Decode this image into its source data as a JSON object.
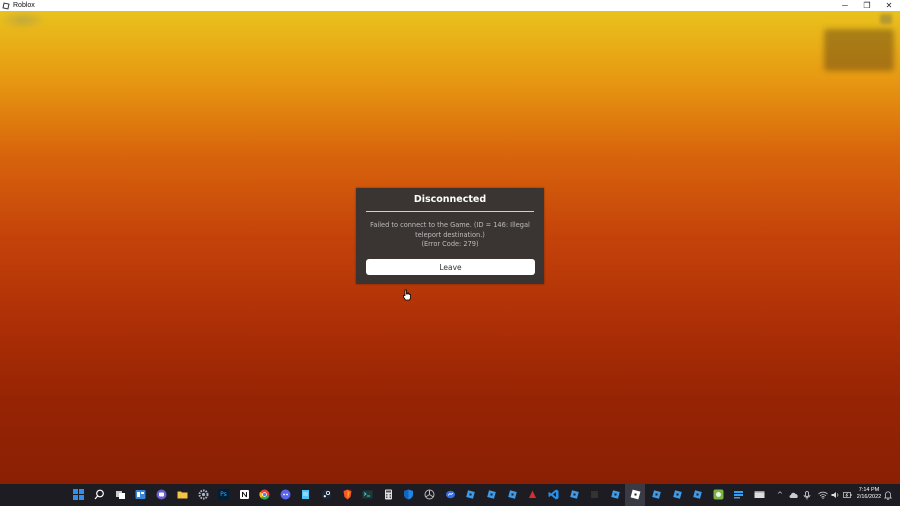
{
  "window": {
    "title": "Roblox",
    "minimize_glyph": "─",
    "maximize_glyph": "❐",
    "close_glyph": "✕"
  },
  "dialog": {
    "title": "Disconnected",
    "message_line1": "Failed to connect to the Game. (ID = 146: Illegal",
    "message_line2": "teleport destination.)",
    "message_line3": "(Error Code: 279)",
    "leave_label": "Leave"
  },
  "taskbar": {
    "photoshop_label": "Ps",
    "tray_chevron": "^",
    "time": "7:14 PM",
    "date": "2/16/2022"
  },
  "colors": {
    "dialog_bg": "#343434",
    "button_bg": "#ffffff",
    "taskbar_bg": "#1c1c22",
    "windows_blue": "#2f8ff0",
    "vscode_blue": "#2a8fe6",
    "chrome_green": "#34a853",
    "discord": "#5865f2"
  }
}
